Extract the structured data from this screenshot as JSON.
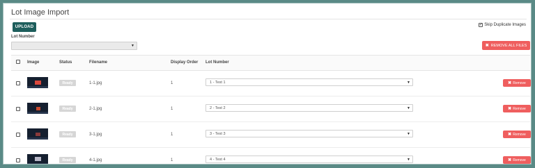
{
  "page": {
    "title": "Lot Image Import",
    "upload_label": "UPLOAD",
    "skip_label": "Skip Duplicate Images",
    "skip_checked": "✓",
    "lot_label": "Lot Number",
    "lot_selected": "",
    "remove_all_label": "REMOVE ALL FILES"
  },
  "table": {
    "headers": {
      "image": "Image",
      "status": "Status",
      "filename": "Filename",
      "display_order": "Display Order",
      "lot_number": "Lot Number"
    },
    "rows": [
      {
        "status": "Ready",
        "filename": "1-1.jpg",
        "order": "1",
        "lot": "1 - Test 1",
        "remove": "Remove"
      },
      {
        "status": "Ready",
        "filename": "2-1.jpg",
        "order": "1",
        "lot": "2 - Test 2",
        "remove": "Remove"
      },
      {
        "status": "Ready",
        "filename": "3-1.jpg",
        "order": "1",
        "lot": "3 - Test 3",
        "remove": "Remove"
      },
      {
        "status": "Ready",
        "filename": "4-1.jpg",
        "order": "1",
        "lot": "4 - Test 4",
        "remove": "Remove"
      }
    ]
  },
  "colors": {
    "primary": "#1e5e5c",
    "danger": "#ef5e5e",
    "badge": "#d6d6d6"
  }
}
